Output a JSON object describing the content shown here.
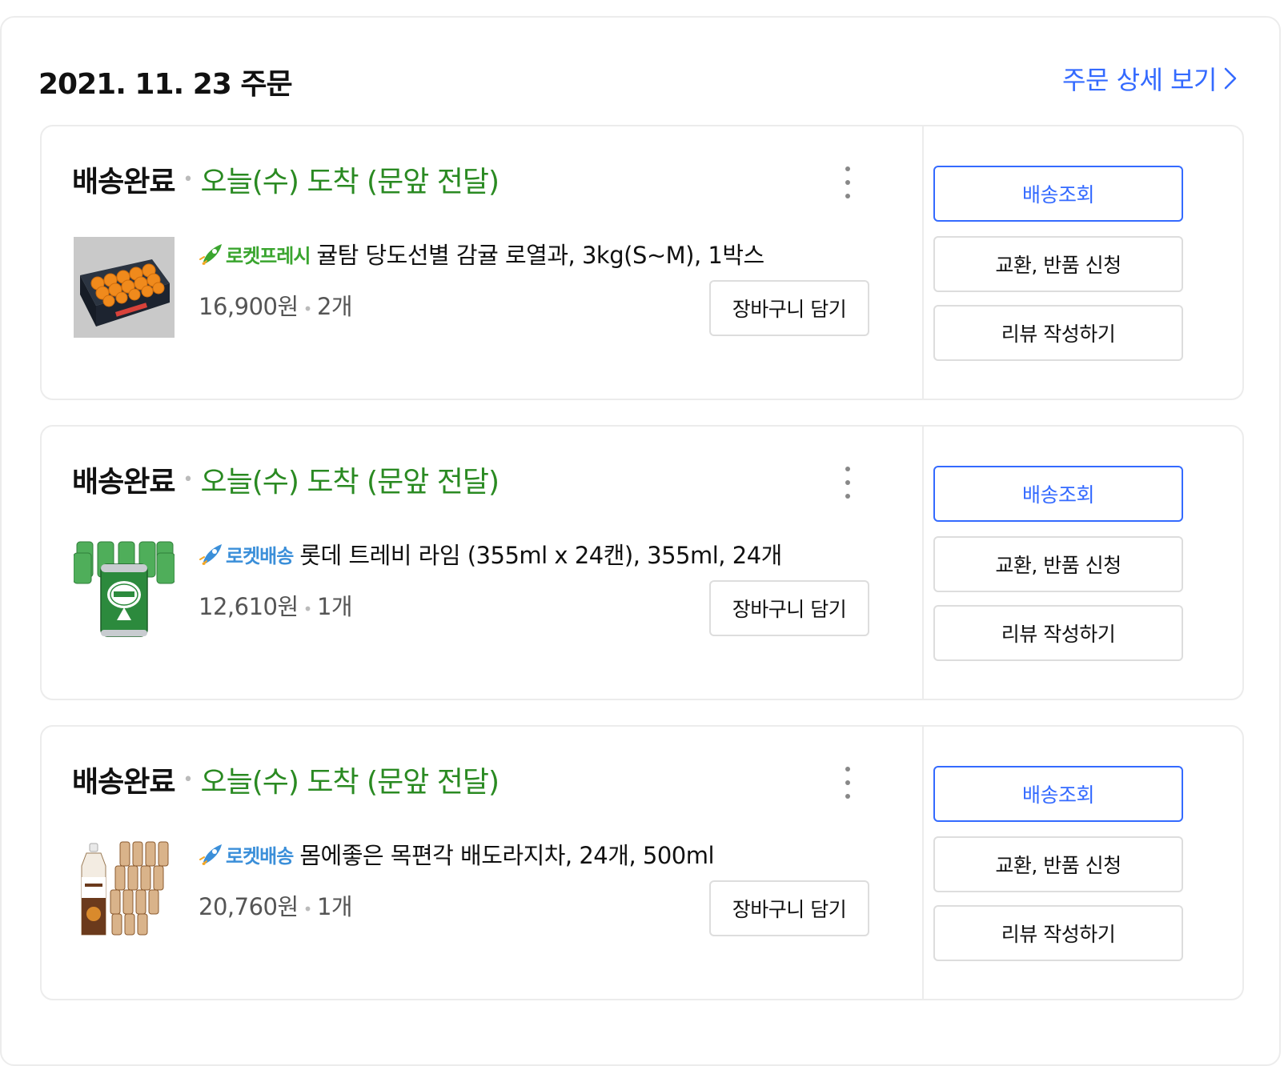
{
  "order": {
    "date_title": "2021. 11. 23 주문",
    "detail_link": "주문 상세 보기"
  },
  "shipments": [
    {
      "status": "배송완료",
      "arrival": "오늘(수) 도착 (문앞 전달)",
      "badge": "로켓프레시",
      "product_name": "귤탐 당도선별 감귤 로열과, 3kg(S~M), 1박스",
      "price": "16,900원",
      "quantity": "2개",
      "cart_button": "장바구니 담기",
      "track_button": "배송조회",
      "exchange_button": "교환, 반품 신청",
      "review_button": "리뷰 작성하기"
    },
    {
      "status": "배송완료",
      "arrival": "오늘(수) 도착 (문앞 전달)",
      "badge": "로켓배송",
      "product_name": "롯데 트레비 라임 (355ml x 24캔), 355ml, 24개",
      "price": "12,610원",
      "quantity": "1개",
      "cart_button": "장바구니 담기",
      "track_button": "배송조회",
      "exchange_button": "교환, 반품 신청",
      "review_button": "리뷰 작성하기"
    },
    {
      "status": "배송완료",
      "arrival": "오늘(수) 도착 (문앞 전달)",
      "badge": "로켓배송",
      "product_name": "몸에좋은 목편각 배도라지차, 24개, 500ml",
      "price": "20,760원",
      "quantity": "1개",
      "cart_button": "장바구니 담기",
      "track_button": "배송조회",
      "exchange_button": "교환, 반품 신청",
      "review_button": "리뷰 작성하기"
    }
  ],
  "colors": {
    "accent_blue": "#346aff",
    "arrival_green": "#2a8a22",
    "fresh_badge_green": "#3aa52f",
    "rocket_badge_blue": "#3b8fd9",
    "border_gray": "#ececec"
  },
  "icons": {
    "detail_link": "chevron-right-icon",
    "more": "more-vertical-icon",
    "fresh_badge": "rocket-fresh-icon",
    "rocket_badge": "rocket-delivery-icon"
  }
}
